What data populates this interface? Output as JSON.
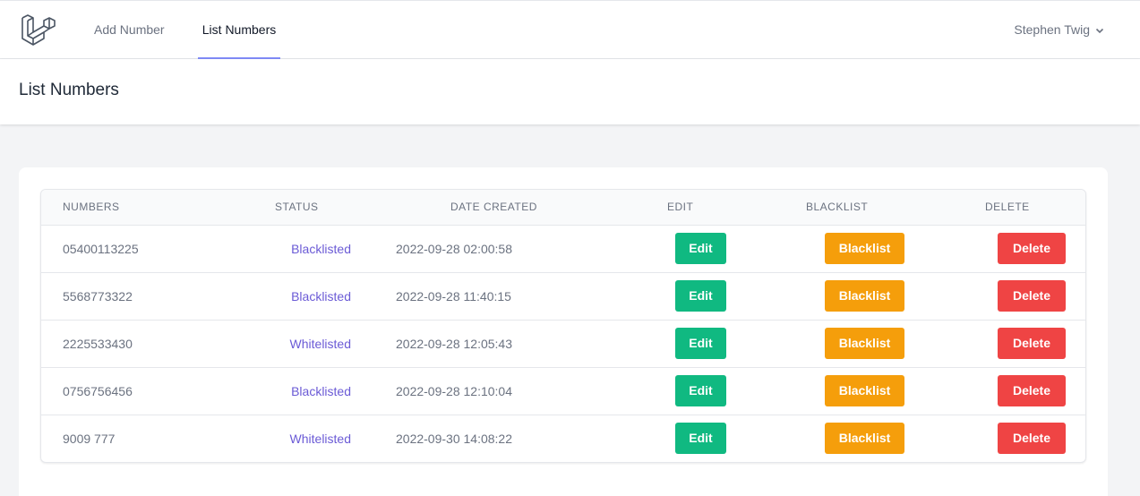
{
  "nav": {
    "links": [
      "Add Number",
      "List Numbers"
    ],
    "active": "List Numbers",
    "user_name": "Stephen Twig"
  },
  "header": {
    "title": "List Numbers"
  },
  "table": {
    "columns": [
      "NUMBERS",
      "STATUS",
      "DATE CREATED",
      "EDIT",
      "BLACKLIST",
      "DELETE"
    ],
    "rows": [
      {
        "number": "05400113225",
        "status": "Blacklisted",
        "date": "2022-09-28 02:00:58"
      },
      {
        "number": "5568773322",
        "status": "Blacklisted",
        "date": "2022-09-28 11:40:15"
      },
      {
        "number": "2225533430",
        "status": "Whitelisted",
        "date": "2022-09-28 12:05:43"
      },
      {
        "number": "0756756456",
        "status": "Blacklisted",
        "date": "2022-09-28 12:10:04"
      },
      {
        "number": "9009 777",
        "status": "Whitelisted",
        "date": "2022-09-30 14:08:22"
      }
    ],
    "edit_label": "Edit",
    "blacklist_label": "Blacklist",
    "delete_label": "Delete"
  },
  "icons": {
    "logo": "laravel-logo-icon",
    "user_menu": "chevron-down-icon"
  },
  "colors": {
    "accent": "#818cf8",
    "status_text": "#6b5bd6",
    "edit": "#10b981",
    "blacklist": "#f59e0b",
    "delete": "#ef4444"
  }
}
